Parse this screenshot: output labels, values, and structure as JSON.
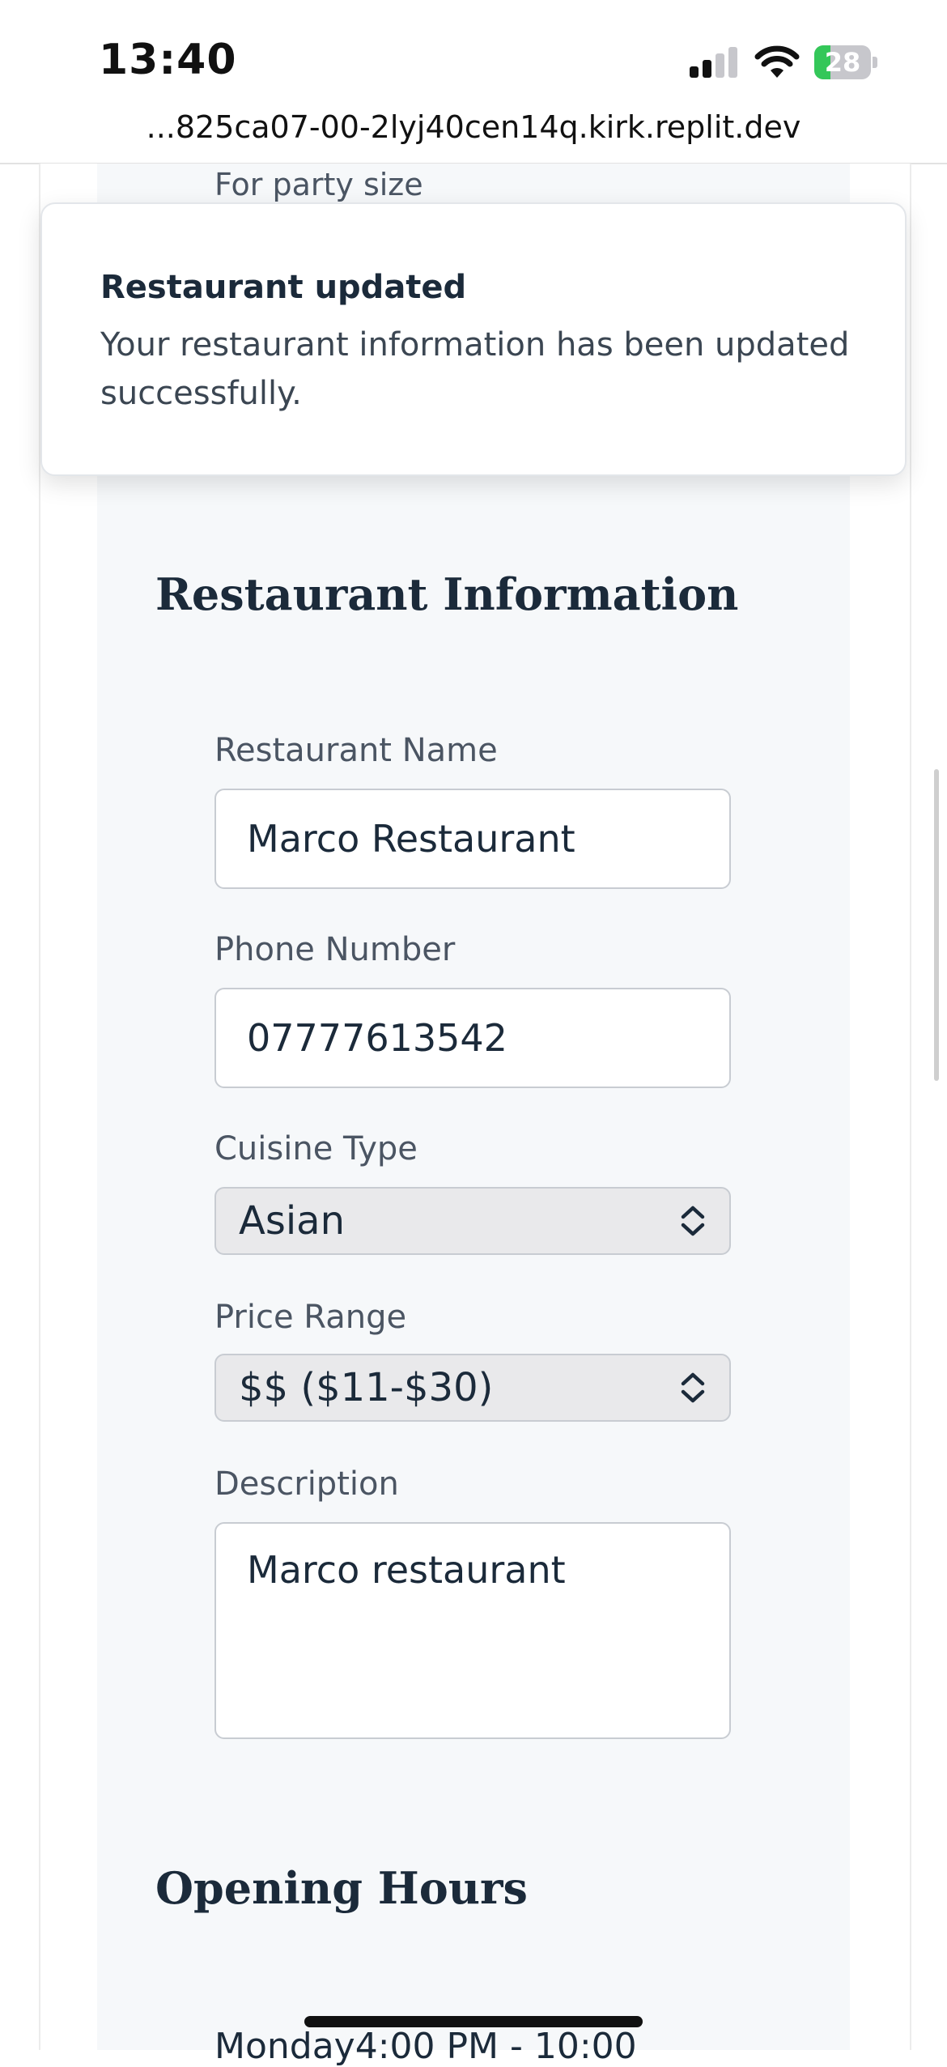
{
  "status_bar": {
    "time": "13:40",
    "battery": "28"
  },
  "browser": {
    "url": "...825ca07-00-2lyj40cen14q.kirk.replit.dev"
  },
  "partial_top_label": "For party size",
  "toast": {
    "title": "Restaurant updated",
    "message": "Your restaurant information has been updated successfully."
  },
  "restaurant_info": {
    "title": "Restaurant Information",
    "name_label": "Restaurant Name",
    "name_value": "Marco Restaurant",
    "phone_label": "Phone Number",
    "phone_value": "07777613542",
    "cuisine_label": "Cuisine Type",
    "cuisine_value": "Asian",
    "price_label": "Price Range",
    "price_value": "$$ ($11-$30)",
    "description_label": "Description",
    "description_value": "Marco restaurant"
  },
  "opening_hours": {
    "title": "Opening Hours",
    "first_row_partial": "Monday4:00 PM - 10:00"
  }
}
